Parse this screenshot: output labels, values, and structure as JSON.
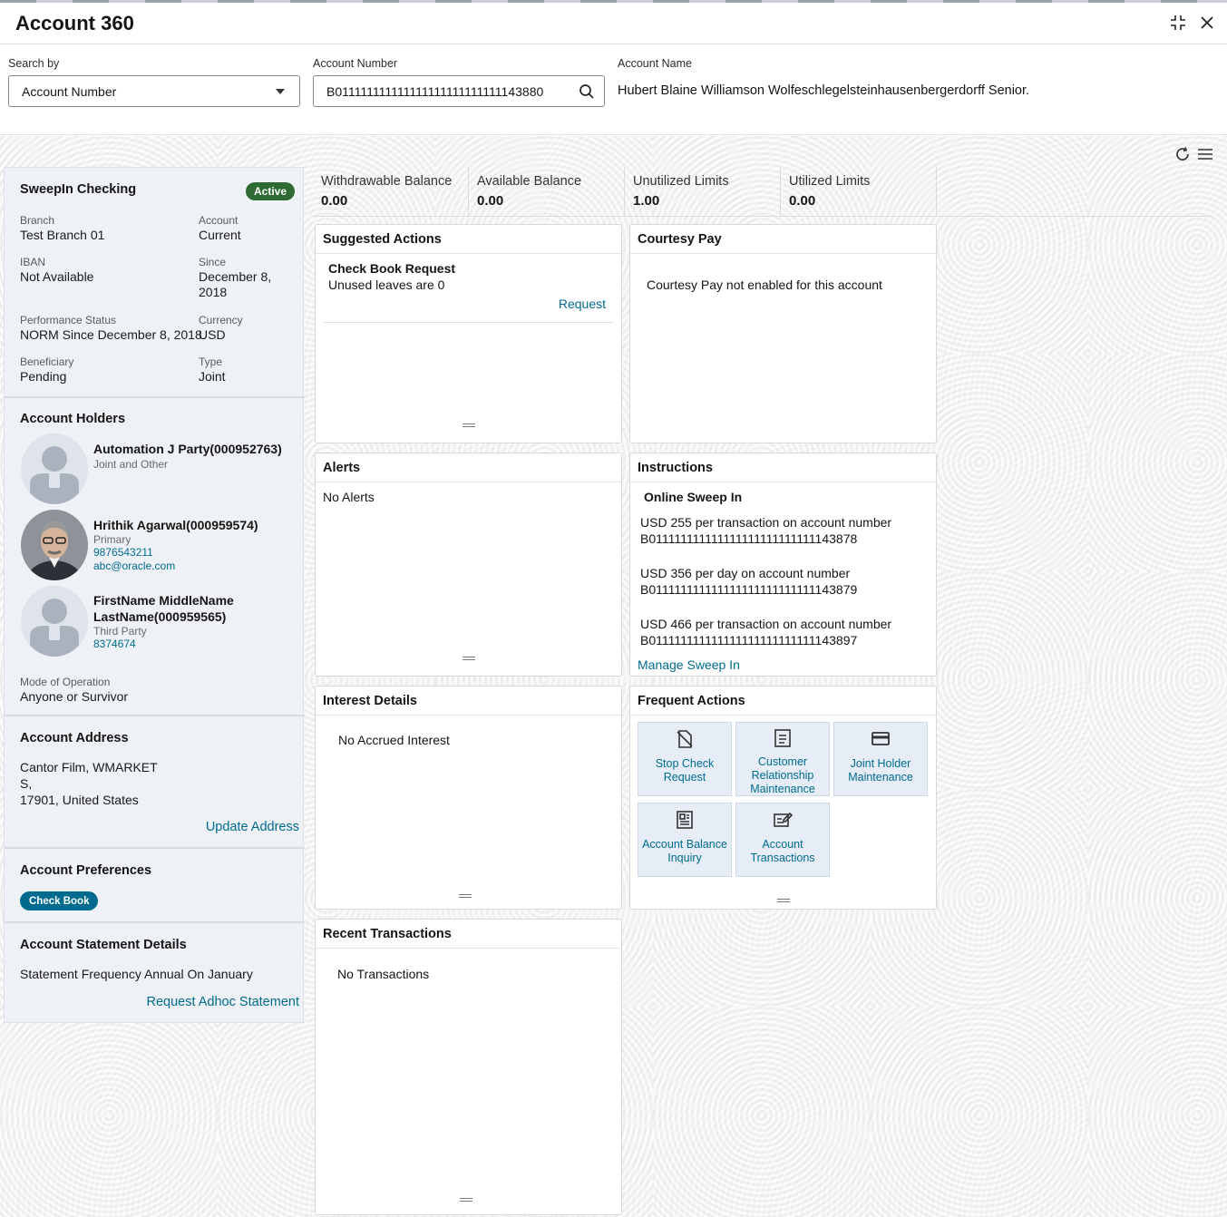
{
  "app": {
    "title": "Account 360",
    "icons": {
      "minimize": "collapse-icon",
      "close": "close-icon",
      "refresh": "refresh-icon",
      "menu": "hamburger-icon"
    }
  },
  "search": {
    "search_by_label": "Search by",
    "search_by_value": "Account Number",
    "account_number_label": "Account Number",
    "account_number_value": "B011111111111111111111111111143880",
    "account_name_label": "Account Name",
    "account_name_value": "Hubert Blaine Williamson Wolfeschlegelsteinhausenbergerdorff Senior."
  },
  "account": {
    "product": "SweepIn Checking",
    "status": "Active",
    "branch_label": "Branch",
    "branch": "Test Branch 01",
    "account_label": "Account",
    "account": "Current",
    "iban_label": "IBAN",
    "iban": "Not Available",
    "since_label": "Since",
    "since_line1": "December 8,",
    "since_line2": "2018",
    "performance_label": "Performance Status",
    "performance": "NORM Since December 8, 2018",
    "currency_label": "Currency",
    "currency": "USD",
    "beneficiary_label": "Beneficiary",
    "beneficiary": "Pending",
    "type_label": "Type",
    "type": "Joint"
  },
  "holders": {
    "title": "Account Holders",
    "list": [
      {
        "name": "Automation J Party(000952763)",
        "role": "Joint and Other"
      },
      {
        "name": "Hrithik Agarwal(000959574)",
        "role": "Primary",
        "phone": "9876543211",
        "email": "abc@oracle.com"
      },
      {
        "name_line1": "FirstName MiddleName",
        "name_line2": "LastName(000959565)",
        "role": "Third Party",
        "phone": "8374674"
      }
    ],
    "mode_label": "Mode of Operation",
    "mode": "Anyone or Survivor"
  },
  "address": {
    "title": "Account Address",
    "line1": "Cantor Film, WMARKET",
    "line2": "S,",
    "line3": "17901, United States",
    "update_link": "Update Address"
  },
  "preferences": {
    "title": "Account Preferences",
    "pill": "Check Book"
  },
  "statement": {
    "title": "Account Statement Details",
    "frequency": "Statement Frequency Annual On January",
    "adhoc_link": "Request Adhoc Statement"
  },
  "balances": [
    {
      "label": "Withdrawable Balance",
      "value": "0.00"
    },
    {
      "label": "Available Balance",
      "value": "0.00"
    },
    {
      "label": "Unutilized Limits",
      "value": "1.00"
    },
    {
      "label": "Utilized Limits",
      "value": "0.00"
    }
  ],
  "suggested": {
    "title": "Suggested Actions",
    "item_title": "Check Book Request",
    "item_desc": "Unused leaves are 0",
    "item_link": "Request"
  },
  "courtesy": {
    "title": "Courtesy Pay",
    "text": "Courtesy Pay not enabled for this account"
  },
  "alerts": {
    "title": "Alerts",
    "text": "No Alerts"
  },
  "instructions": {
    "title": "Instructions",
    "subtitle": "Online Sweep In",
    "items": [
      {
        "line1": "USD 255 per transaction on account number",
        "line2": "B011111111111111111111111111143878"
      },
      {
        "line1": "USD 356 per day on account number",
        "line2": "B011111111111111111111111111143879"
      },
      {
        "line1": "USD 466 per transaction on account number",
        "line2": "B011111111111111111111111111143897"
      }
    ],
    "link": "Manage Sweep In"
  },
  "interest": {
    "title": "Interest Details",
    "text": "No Accrued Interest"
  },
  "frequent": {
    "title": "Frequent Actions",
    "actions": [
      {
        "line1": "Stop Check",
        "line2": "Request",
        "line3": "",
        "icon": "stop-check-icon"
      },
      {
        "line1": "Customer",
        "line2": "Relationship",
        "line3": "Maintenance",
        "icon": "document-icon"
      },
      {
        "line1": "Joint Holder",
        "line2": "Maintenance",
        "line3": "",
        "icon": "card-icon"
      },
      {
        "line1": "Account Balance",
        "line2": "Inquiry",
        "line3": "",
        "icon": "ledger-icon"
      },
      {
        "line1": "Account",
        "line2": "Transactions",
        "line3": "",
        "icon": "edit-icon"
      }
    ]
  },
  "transactions": {
    "title": "Recent Transactions",
    "text": "No Transactions"
  },
  "colors": {
    "link": "#006b8f",
    "active_badge": "#2e6b33",
    "pill": "#006b8f",
    "left_panel": "#eef1f6",
    "tile": "#e6edf7"
  }
}
